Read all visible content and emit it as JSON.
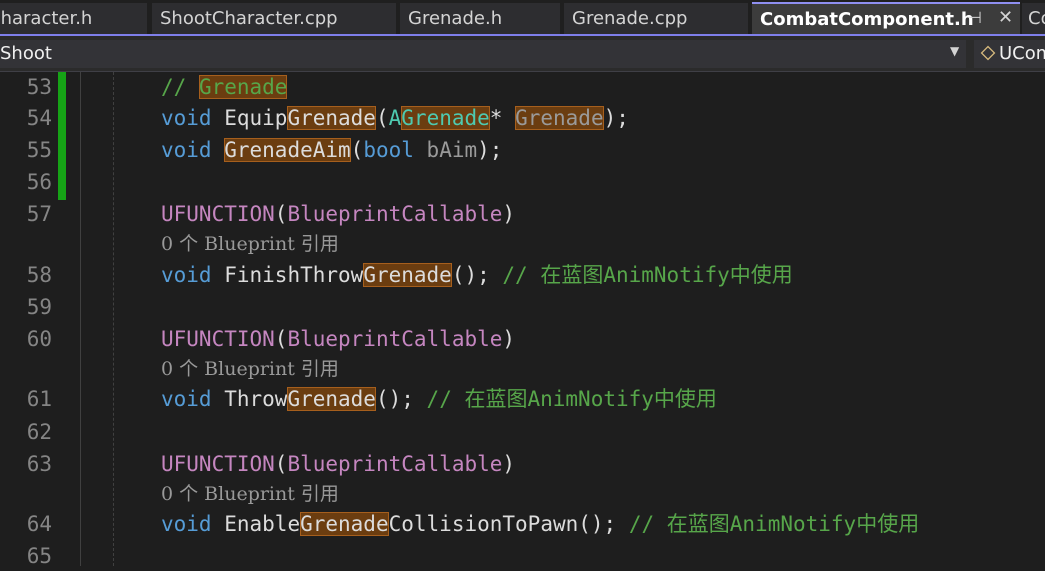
{
  "tabs": [
    {
      "label": "Character.h"
    },
    {
      "label": "ShootCharacter.cpp"
    },
    {
      "label": "Grenade.h"
    },
    {
      "label": "Grenade.cpp"
    },
    {
      "label": "CombatComponent.h"
    },
    {
      "label": "Co"
    }
  ],
  "tab_icons": {
    "pin": "pin-icon",
    "close": "close-icon"
  },
  "nav": {
    "scope": "Shoot",
    "member": "UCom"
  },
  "colors": {
    "accent": "#7f7fea",
    "keyword": "#569cd6",
    "type": "#4ec9b0",
    "macro": "#c586c0",
    "comment": "#57a64a",
    "highlight": "#6b3d10",
    "change_marker": "#16a316"
  },
  "lines": [
    {
      "n": "53",
      "indent": "    ",
      "comment": "// ",
      "comment_hl": "Grenade"
    },
    {
      "n": "54",
      "kw": "void",
      "fn_a": "Equip",
      "fn_hl": "Grenade",
      "p1": "(",
      "ty_a": "A",
      "ty_hl": "Grenade",
      "p2": "* ",
      "param_hl": "Grenade",
      "p3": ");"
    },
    {
      "n": "55",
      "kw": "void",
      "fn_hl": "GrenadeAim",
      "p1": "(",
      "kw2": "bool",
      "param": " bAim",
      "p2": ");"
    },
    {
      "n": "56"
    },
    {
      "n": "57",
      "macro": "UFUNCTION",
      "p1": "(",
      "spec": "BlueprintCallable",
      "p2": ")",
      "lens": "0 个 Blueprint 引用"
    },
    {
      "n": "58",
      "kw": "void",
      "fn_a": "FinishThrow",
      "fn_hl": "Grenade",
      "p1": "(); ",
      "comment": "// 在蓝图AnimNotify中使用"
    },
    {
      "n": "59"
    },
    {
      "n": "60",
      "macro": "UFUNCTION",
      "p1": "(",
      "spec": "BlueprintCallable",
      "p2": ")",
      "lens": "0 个 Blueprint 引用"
    },
    {
      "n": "61",
      "kw": "void",
      "fn_a": "Throw",
      "fn_hl": "Grenade",
      "p1": "(); ",
      "comment": "// 在蓝图AnimNotify中使用"
    },
    {
      "n": "62"
    },
    {
      "n": "63",
      "macro": "UFUNCTION",
      "p1": "(",
      "spec": "BlueprintCallable",
      "p2": ")",
      "lens": "0 个 Blueprint 引用"
    },
    {
      "n": "64",
      "kw": "void",
      "fn_a": "Enable",
      "fn_hl": "Grenade",
      "fn_b": "CollisionToPawn",
      "p1": "(); ",
      "comment": "// 在蓝图AnimNotify中使用"
    },
    {
      "n": "65"
    }
  ]
}
